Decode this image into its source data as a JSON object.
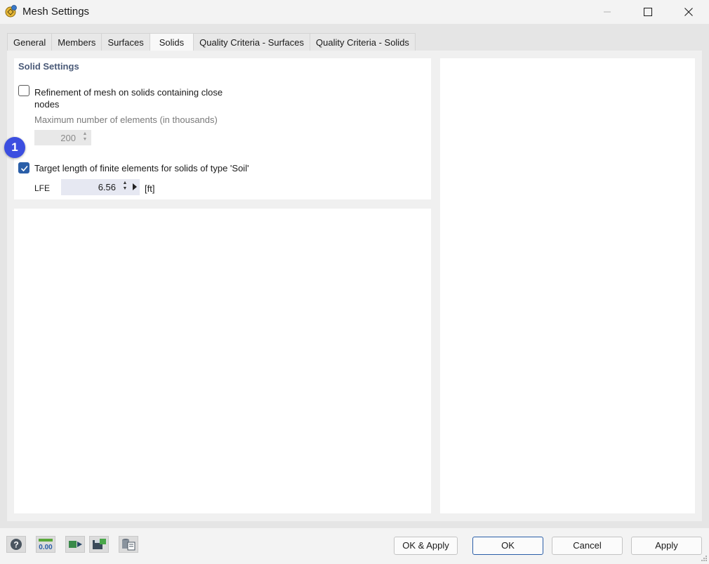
{
  "window": {
    "title": "Mesh Settings",
    "icons": {
      "app": "mesh-settings-app-icon",
      "minimize": "minimize-icon",
      "maximize": "maximize-icon",
      "close": "close-icon"
    }
  },
  "tabs": [
    {
      "label": "General",
      "active": false
    },
    {
      "label": "Members",
      "active": false
    },
    {
      "label": "Surfaces",
      "active": false
    },
    {
      "label": "Solids",
      "active": true
    },
    {
      "label": "Quality Criteria - Surfaces",
      "active": false
    },
    {
      "label": "Quality Criteria - Solids",
      "active": false
    }
  ],
  "solid_settings": {
    "group_title": "Solid Settings",
    "refinement": {
      "label": "Refinement of mesh on solids containing close nodes",
      "checked": false,
      "max_elements_label": "Maximum number of elements (in thousands)",
      "max_elements_value": "200"
    },
    "target_length": {
      "label": "Target length of finite elements for solids of type 'Soil'",
      "checked": true,
      "lfe_label": "LFE",
      "lfe_value": "6.56",
      "unit": "[ft]"
    },
    "annotation_badge": "1"
  },
  "footer": {
    "tool_icons": [
      "help-icon",
      "units-decimal-icon",
      "import-export-icon",
      "save-settings-icon",
      "database-settings-icon"
    ],
    "buttons": {
      "ok_apply": "OK & Apply",
      "ok": "OK",
      "cancel": "Cancel",
      "apply": "Apply"
    }
  },
  "colors": {
    "accent": "#2a5ea8",
    "badge": "#3b4ee0",
    "group_title": "#4a5a78"
  }
}
